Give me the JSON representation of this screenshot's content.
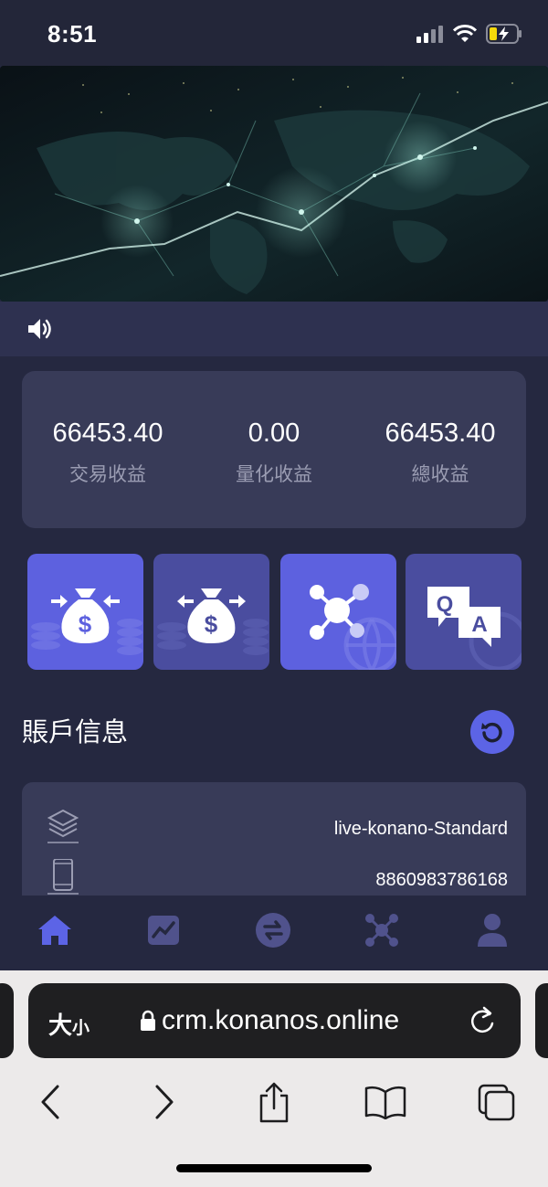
{
  "status_bar": {
    "time": "8:51"
  },
  "stats": [
    {
      "value": "66453.40",
      "label": "交易收益"
    },
    {
      "value": "0.00",
      "label": "量化收益"
    },
    {
      "value": "66453.40",
      "label": "總收益"
    }
  ],
  "account": {
    "title": "賬戶信息",
    "rows": [
      {
        "icon": "layers-icon",
        "value": "live-konano-Standard"
      },
      {
        "icon": "phone-icon",
        "value": "8860983786168"
      }
    ]
  },
  "tiles": [
    {
      "name": "deposit-tile",
      "icon": "money-bag-in-icon",
      "color": "#5d61df"
    },
    {
      "name": "withdraw-tile",
      "icon": "money-bag-out-icon",
      "color": "#4a4d9f"
    },
    {
      "name": "network-tile",
      "icon": "network-icon",
      "color": "#5d61df"
    },
    {
      "name": "faq-tile",
      "icon": "qa-icon",
      "color": "#4a4d9f"
    }
  ],
  "bottom_nav": [
    {
      "name": "nav-home",
      "icon": "home-icon",
      "active": true
    },
    {
      "name": "nav-chart",
      "icon": "chart-icon",
      "active": false
    },
    {
      "name": "nav-transfer",
      "icon": "transfer-icon",
      "active": false
    },
    {
      "name": "nav-network",
      "icon": "network-icon",
      "active": false
    },
    {
      "name": "nav-profile",
      "icon": "user-icon",
      "active": false
    }
  ],
  "browser": {
    "aa_big": "大",
    "aa_small": "小",
    "url": "crm.konanos.online"
  },
  "colors": {
    "background": "#252840",
    "card": "#383b58",
    "accent": "#5c64e6",
    "nav_inactive": "#50528c"
  }
}
